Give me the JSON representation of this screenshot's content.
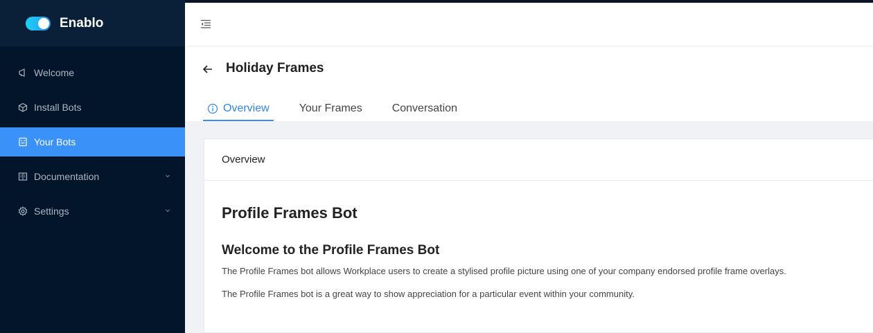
{
  "brand": {
    "name": "Enablo",
    "toggle_color": "#1bd3f3"
  },
  "sidebar": {
    "items": [
      {
        "label": "Welcome",
        "icon": "megaphone-icon",
        "active": false,
        "expandable": false
      },
      {
        "label": "Install Bots",
        "icon": "cube-icon",
        "active": false,
        "expandable": false
      },
      {
        "label": "Your Bots",
        "icon": "robot-icon",
        "active": true,
        "expandable": false
      },
      {
        "label": "Documentation",
        "icon": "book-icon",
        "active": false,
        "expandable": true
      },
      {
        "label": "Settings",
        "icon": "gear-icon",
        "active": false,
        "expandable": true
      }
    ]
  },
  "topbar": {
    "menu_toggle_icon": "menu-fold-icon"
  },
  "page": {
    "title": "Holiday Frames",
    "back_icon": "arrow-left-icon",
    "tabs": [
      {
        "label": "Overview",
        "icon": "info-circle-icon",
        "active": true
      },
      {
        "label": "Your Frames",
        "active": false
      },
      {
        "label": "Conversation",
        "active": false
      }
    ]
  },
  "card": {
    "header": "Overview",
    "heading": "Profile Frames Bot",
    "subheading": "Welcome to the Profile Frames Bot",
    "paragraphs": [
      "The Profile Frames bot allows Workplace users to create a stylised profile picture using one of your company endorsed profile frame overlays.",
      "The Profile Frames bot is a great way to show appreciation for a particular event within your community."
    ]
  },
  "colors": {
    "accent": "#3a91f8",
    "sidebar_bg": "#02152a"
  }
}
